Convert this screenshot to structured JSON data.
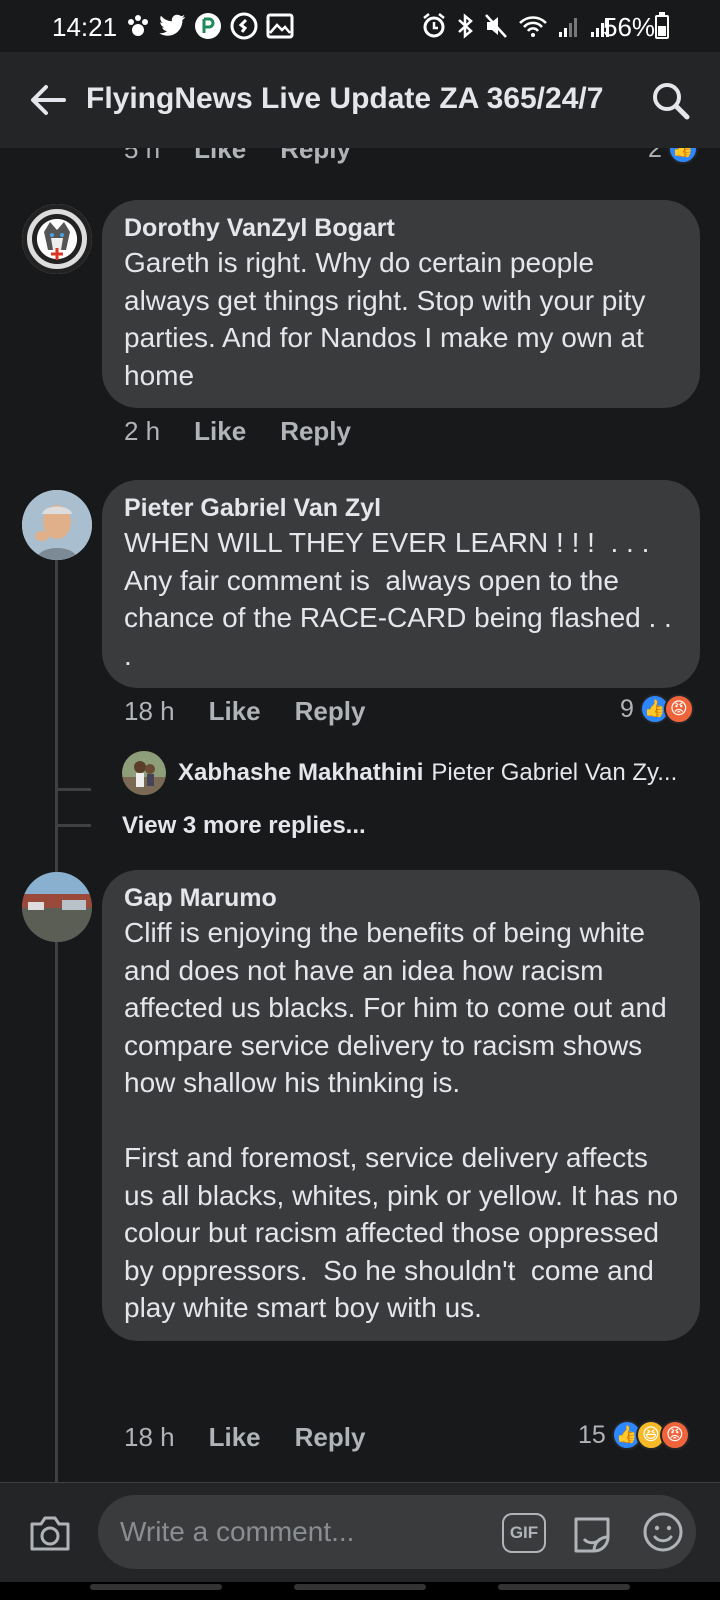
{
  "status_bar": {
    "time": "14:21",
    "battery": "56%",
    "battery_level": 0.56
  },
  "header": {
    "title": "FlyingNews Live Update ZA 365/24/7"
  },
  "top_partial": {
    "time": "5 h",
    "like": "Like",
    "reply": "Reply",
    "reaction_count": "2"
  },
  "comments": [
    {
      "author": "Dorothy VanZyl Bogart",
      "text": "Gareth is right. Why do certain people always get things right. Stop with your pity parties. And for Nandos I make my own at home",
      "time": "2 h",
      "like": "Like",
      "reply": "Reply"
    },
    {
      "author": "Pieter Gabriel Van Zyl",
      "text": "WHEN WILL THEY EVER LEARN ! ! !  . . . Any fair comment is  always open to the chance of the RACE-CARD being flashed . . .",
      "time": "18 h",
      "like": "Like",
      "reply": "Reply",
      "reaction_count": "9",
      "reactions": [
        "like",
        "angry"
      ],
      "reply_preview": {
        "author": "Xabhashe Makhathini",
        "text": "Pieter Gabriel Van Zy..."
      },
      "view_more": "View 3 more replies..."
    },
    {
      "author": "Gap Marumo",
      "text": "Cliff is enjoying the benefits of being white and does not have an idea how racism affected us blacks. For him to come out and compare service delivery to racism shows how shallow his thinking is.\n\nFirst and foremost, service delivery affects us all blacks, whites, pink or yellow. It has no colour but racism affected those oppressed  by oppressors.  So he shouldn't  come and play white smart boy with us.",
      "time": "18 h",
      "like": "Like",
      "reply": "Reply",
      "reaction_count": "15",
      "reactions": [
        "like",
        "haha",
        "angry"
      ]
    }
  ],
  "composer": {
    "placeholder": "Write a comment...",
    "gif_label": "GIF"
  },
  "colors": {
    "background": "#18191a",
    "bubble": "#3a3b3c",
    "secondary_text": "#b0b3b8",
    "like_blue": "#2d88ff",
    "angry_orange": "#f0643b"
  }
}
